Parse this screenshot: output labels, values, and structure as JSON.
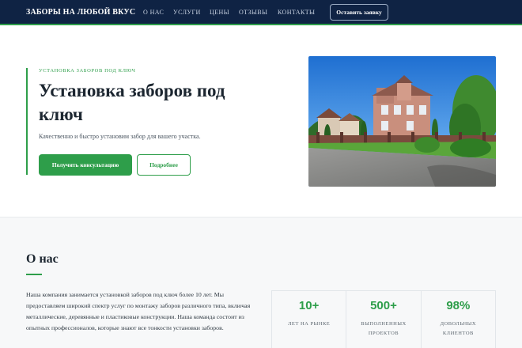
{
  "header": {
    "logo": "ЗАБОРЫ НА ЛЮБОЙ ВКУС",
    "nav": [
      "О НАС",
      "УСЛУГИ",
      "ЦЕНЫ",
      "ОТЗЫВЫ",
      "КОНТАКТЫ"
    ],
    "cta_label": "Оставить заявку"
  },
  "hero": {
    "kicker": "УСТАНОВКА ЗАБОРОВ ПОД КЛЮЧ",
    "title": "Установка заборов под ключ",
    "subtitle": "Качественно и быстро установим забор для вашего участка.",
    "primary_button": "Получить консультацию",
    "secondary_button": "Подробнее"
  },
  "about": {
    "title": "О нас",
    "text": "Наша компания занимается установкой заборов под ключ более 10 лет. Мы предоставляем широкий спектр услуг по монтажу заборов различного типа, включая металлические, деревянные и пластиковые конструкции. Наша команда состоит из опытных профессионалов, которые знают все тонкости установки заборов.",
    "stats": [
      {
        "value": "10+",
        "label": "ЛЕТ НА РЫНКЕ"
      },
      {
        "value": "500+",
        "label": "ВЫПОЛНЕННЫХ ПРОЕКТОВ"
      },
      {
        "value": "98%",
        "label": "ДОВОЛЬНЫХ КЛИЕНТОВ"
      }
    ]
  },
  "colors": {
    "header_bg": "#0f2344",
    "accent": "#2e9e4a"
  }
}
